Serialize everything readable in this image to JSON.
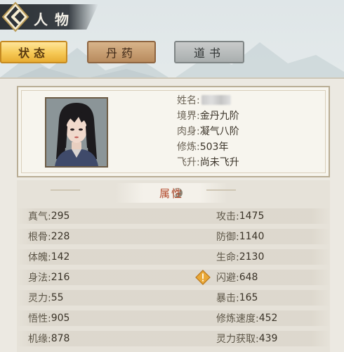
{
  "header": {
    "title": "人物"
  },
  "tabs": [
    {
      "label": "状态",
      "active": true
    },
    {
      "label": "丹药",
      "active": false
    },
    {
      "label": "道书",
      "active": false
    }
  ],
  "character": {
    "name_label": "姓名:",
    "realm_label": "境界:",
    "realm_value": "金丹九阶",
    "body_label": "肉身:",
    "body_value": "凝气八阶",
    "cultivation_label": "修炼:",
    "cultivation_value": "503年",
    "ascend_label": "飞升:",
    "ascend_value": "尚未飞升"
  },
  "attributes": {
    "title": "属性",
    "left": [
      {
        "label": "真气:",
        "value": "295"
      },
      {
        "label": "根骨:",
        "value": "228"
      },
      {
        "label": "体魄:",
        "value": "142"
      },
      {
        "label": "身法:",
        "value": "216"
      },
      {
        "label": "灵力:",
        "value": "55"
      },
      {
        "label": "悟性:",
        "value": "905"
      },
      {
        "label": "机缘:",
        "value": "878"
      }
    ],
    "right": [
      {
        "label": "攻击:",
        "value": "1475"
      },
      {
        "label": "防御:",
        "value": "1140"
      },
      {
        "label": "生命:",
        "value": "2130"
      },
      {
        "label": "闪避:",
        "value": "648"
      },
      {
        "label": "暴击:",
        "value": "165"
      },
      {
        "label": "修炼速度:",
        "value": "452"
      },
      {
        "label": "灵力获取:",
        "value": "439"
      }
    ]
  },
  "colors": {
    "active_tab": "#f6c955",
    "attr_title": "#b34a2c",
    "warning_icon": "#e9a838"
  }
}
